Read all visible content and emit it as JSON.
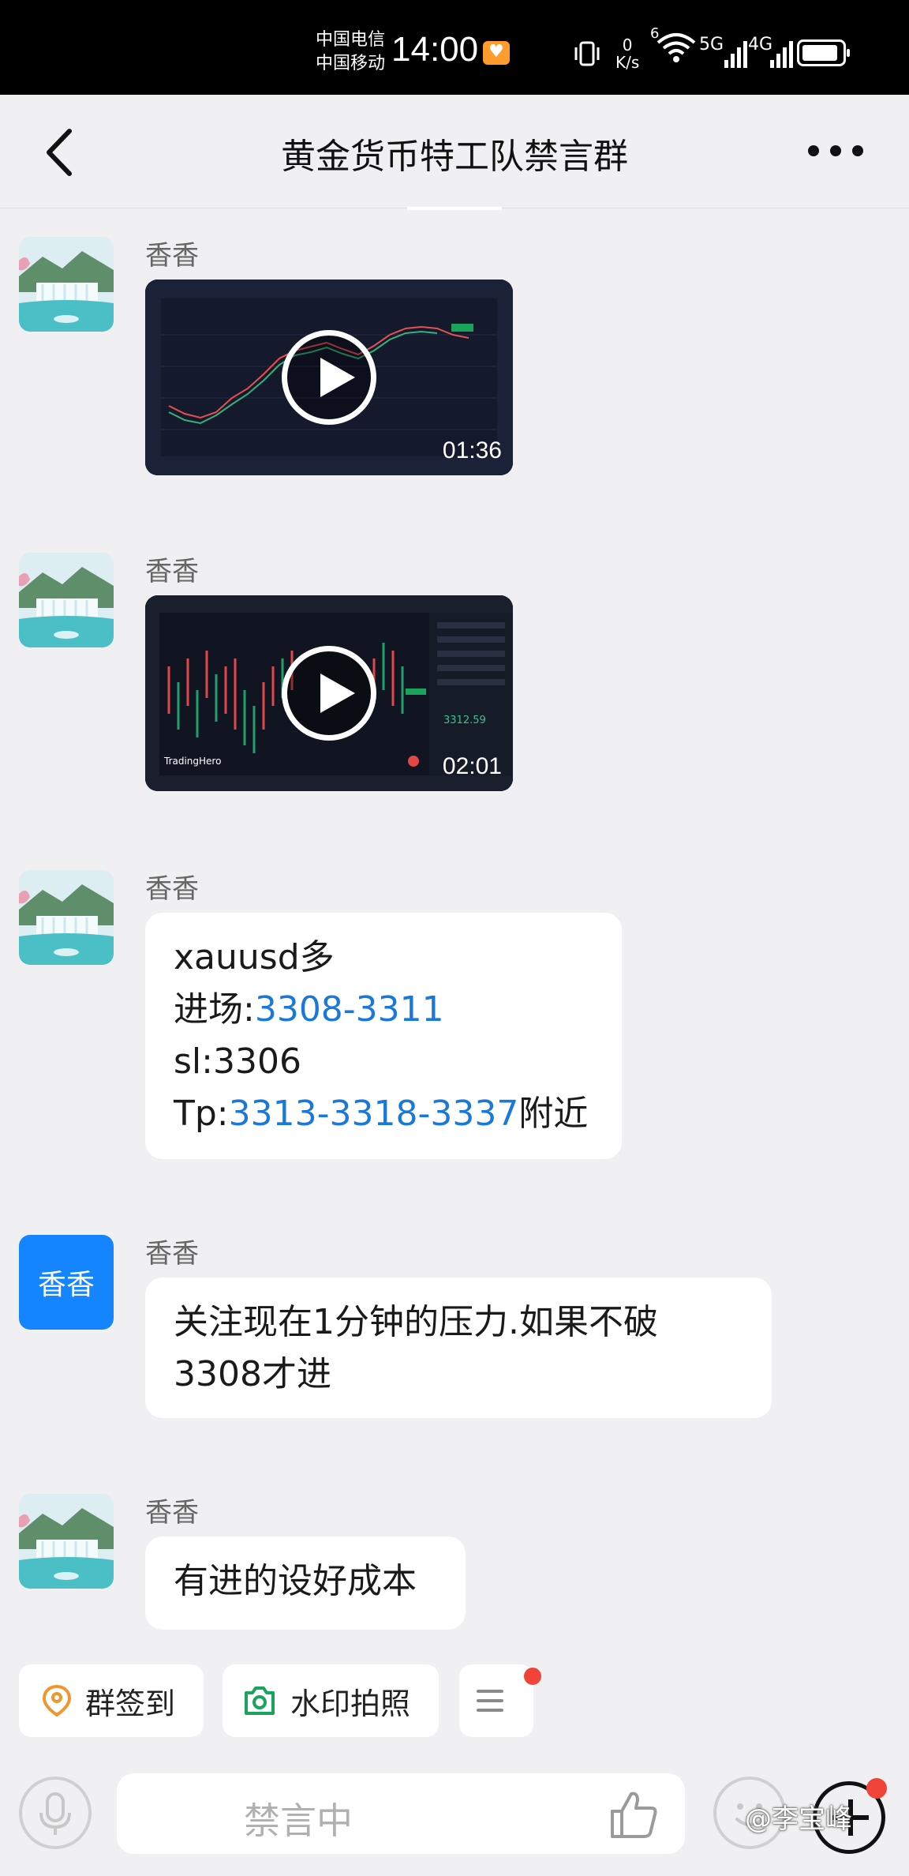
{
  "status_bar": {
    "carrier_1": "中国电信",
    "carrier_2": "中国移动",
    "time": "14:00",
    "net_speed_value": "0",
    "net_speed_unit": "K/s",
    "wifi_badge": "6",
    "signal_1": "5G",
    "signal_2": "4G"
  },
  "header": {
    "title": "黄金货币特工队禁言群"
  },
  "messages": [
    {
      "sender": "香香",
      "type": "video",
      "duration": "01:36"
    },
    {
      "sender": "香香",
      "type": "video",
      "duration": "02:01",
      "chart_price": "3312.59",
      "chart_brand": "TradingHero"
    },
    {
      "sender": "香香",
      "type": "text",
      "lines": {
        "l1": "xauusd多",
        "l2_prefix": "进场:",
        "l2_link": "3308-3311",
        "l3": "sl:3306",
        "l4_prefix": "Tp:",
        "l4_link": "3313-3318-3337",
        "l4_suffix": "附近"
      }
    },
    {
      "sender": "香香",
      "avatar_text": "香香",
      "type": "text",
      "text": "关注现在1分钟的压力.如果不破3308才进"
    },
    {
      "sender": "香香",
      "type": "text",
      "text": "有进的设好成本"
    }
  ],
  "quick_actions": {
    "checkin": "群签到",
    "watermark_photo": "水印拍照"
  },
  "input_bar": {
    "muted_text": "禁言中"
  },
  "watermark": "@李宝峰",
  "colors": {
    "link": "#1a78d8",
    "avatar_blue": "#1485ff",
    "badge_red": "#f04438",
    "checkin_orange": "#f0962e",
    "camera_green": "#1aa35a"
  }
}
